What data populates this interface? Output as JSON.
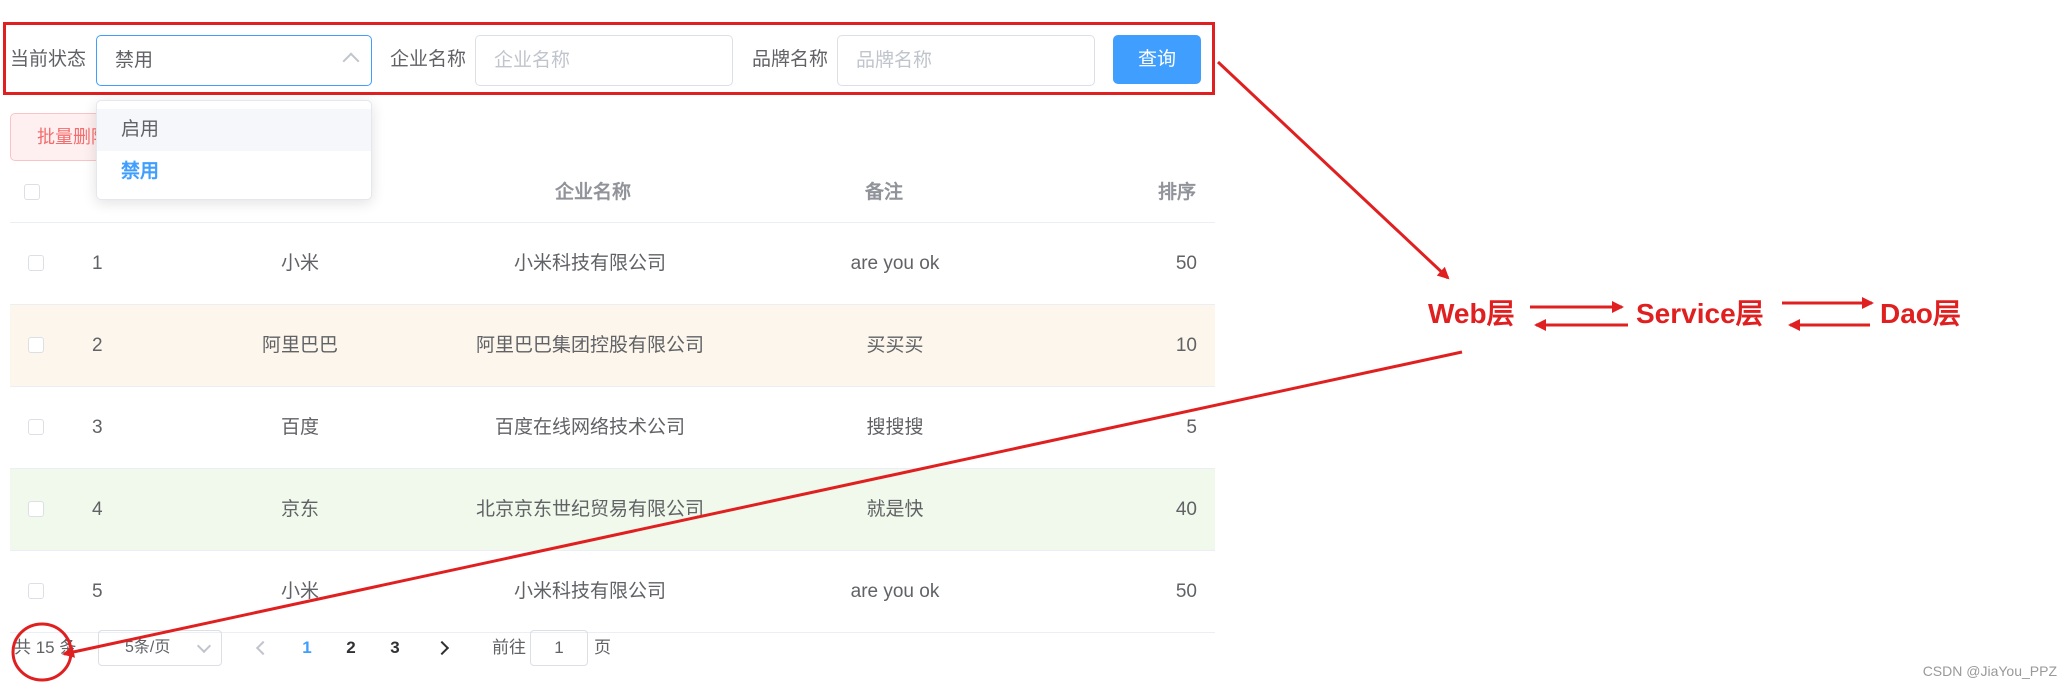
{
  "search_form": {
    "status_label": "当前状态",
    "status_value": "禁用",
    "company_label": "企业名称",
    "company_placeholder": "企业名称",
    "brand_label": "品牌名称",
    "brand_placeholder": "品牌名称",
    "query_button": "查询"
  },
  "status_dropdown": {
    "options": [
      "启用",
      "禁用"
    ],
    "hovered": "启用",
    "selected": "禁用"
  },
  "toolbar": {
    "batch_delete": "批量删除"
  },
  "table": {
    "headers": {
      "company": "企业名称",
      "remark": "备注",
      "sort": "排序"
    },
    "rows": [
      {
        "index": "1",
        "brand": "小米",
        "company": "小米科技有限公司",
        "remark": "are you ok",
        "sort": "50"
      },
      {
        "index": "2",
        "brand": "阿里巴巴",
        "company": "阿里巴巴集团控股有限公司",
        "remark": "买买买",
        "sort": "10"
      },
      {
        "index": "3",
        "brand": "百度",
        "company": "百度在线网络技术公司",
        "remark": "搜搜搜",
        "sort": "5"
      },
      {
        "index": "4",
        "brand": "京东",
        "company": "北京京东世纪贸易有限公司",
        "remark": "就是快",
        "sort": "40"
      },
      {
        "index": "5",
        "brand": "小米",
        "company": "小米科技有限公司",
        "remark": "are you ok",
        "sort": "50"
      }
    ]
  },
  "pagination": {
    "total_text": "共 15 条",
    "page_size": "5条/页",
    "pages": [
      "1",
      "2",
      "3"
    ],
    "current_page": "1",
    "goto_prefix": "前往",
    "goto_value": "1",
    "goto_suffix": "页"
  },
  "annotations": {
    "web_layer": "Web层",
    "service_layer": "Service层",
    "dao_layer": "Dao层",
    "accent_color": "#e02020"
  },
  "watermark": "CSDN @JiaYou_PPZ",
  "colors": {
    "primary": "#409eff",
    "danger": "#f56c6c",
    "row_warning": "#fdf6ec",
    "row_success": "#f0f9eb"
  }
}
